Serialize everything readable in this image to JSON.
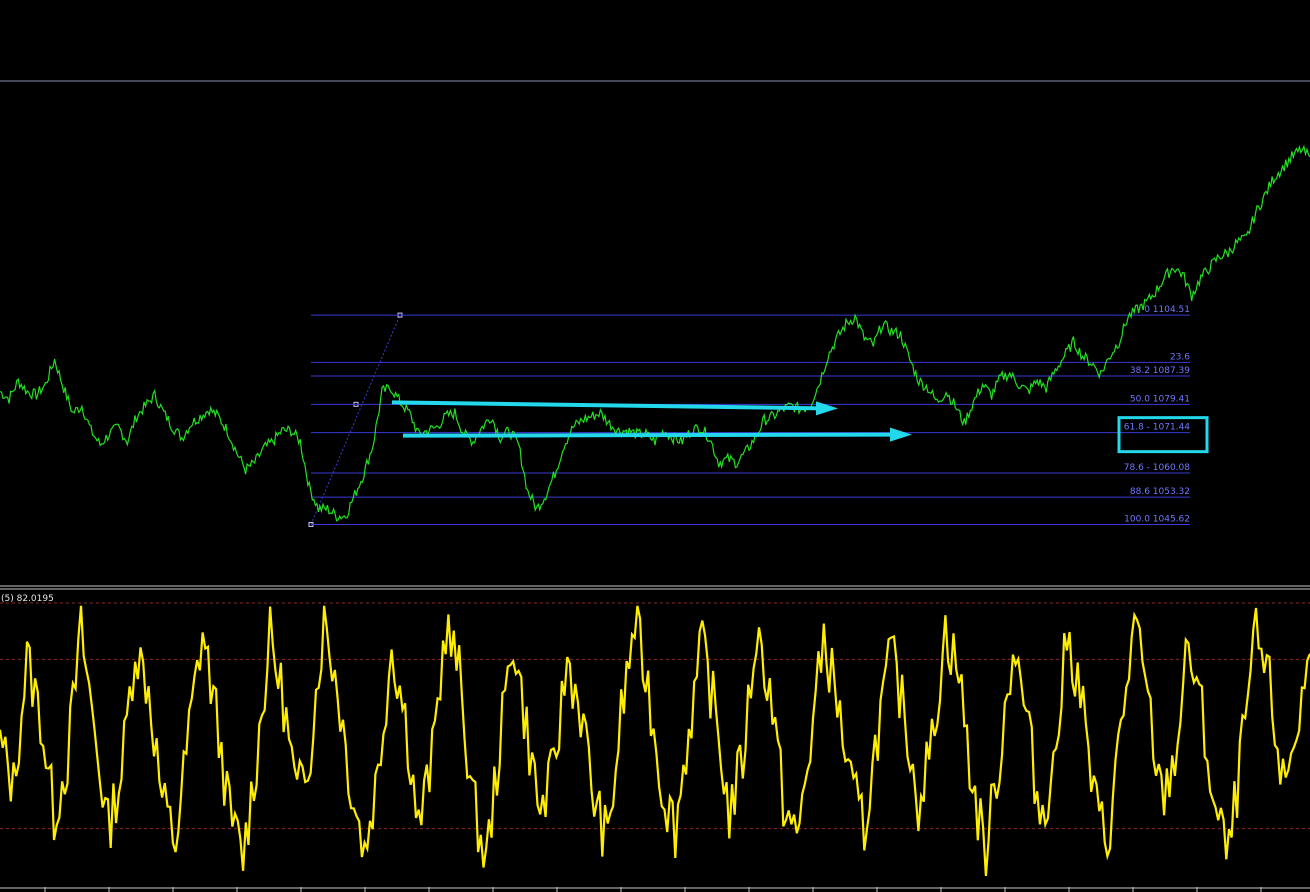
{
  "colors": {
    "background": "#000000",
    "price_line": "#22e022",
    "oscillator_line": "#ffee00",
    "fib_lines": "#3a3ad8",
    "fib_labels": "#6f78ff",
    "annotation_arrows": "#22d8ea",
    "annotation_box": "#22d8ea",
    "separator": "#c8c8c8",
    "level_dashes": "#8a2a2a"
  },
  "chart_data": [
    {
      "type": "line",
      "panel": "price",
      "series": [
        {
          "values": [
            1083,
            1081,
            1086,
            1083,
            1082,
            1085,
            1092,
            1084,
            1077,
            1079,
            1072,
            1068,
            1071,
            1073,
            1069,
            1076,
            1079,
            1082,
            1077,
            1073,
            1070,
            1074,
            1076,
            1078,
            1076,
            1072,
            1066,
            1061,
            1063,
            1067,
            1069,
            1072,
            1072,
            1069,
            1056,
            1050,
            1050,
            1048,
            1048,
            1054,
            1060,
            1068,
            1083,
            1084,
            1080,
            1077,
            1071,
            1072,
            1073,
            1076,
            1077,
            1071,
            1069,
            1073,
            1076,
            1070,
            1072,
            1068,
            1055,
            1050,
            1054,
            1060,
            1068,
            1073,
            1075,
            1076,
            1077,
            1074,
            1072,
            1072,
            1071,
            1071,
            1069,
            1072,
            1070,
            1069,
            1072,
            1073,
            1070,
            1063,
            1064,
            1063,
            1066,
            1070,
            1075,
            1076,
            1078,
            1079,
            1078,
            1079,
            1085,
            1093,
            1098,
            1102,
            1104,
            1098,
            1096,
            1102,
            1100,
            1099,
            1092,
            1086,
            1084,
            1080,
            1083,
            1079,
            1074,
            1080,
            1085,
            1082,
            1087,
            1088,
            1085,
            1083,
            1086,
            1084,
            1089,
            1093,
            1097,
            1093,
            1091,
            1088,
            1093,
            1097,
            1104,
            1106,
            1108,
            1111,
            1115,
            1118,
            1116,
            1110,
            1115,
            1118,
            1121,
            1122,
            1125,
            1126,
            1133,
            1138,
            1143,
            1146,
            1149,
            1151,
            1149
          ]
        }
      ],
      "fibonacci": {
        "levels": [
          {
            "level": "0",
            "value": 1104.51,
            "label": "0 1104.51"
          },
          {
            "level": "23.6",
            "value": 1091.22,
            "label": "23.6"
          },
          {
            "level": "38.2",
            "value": 1087.39,
            "label": "38.2 1087.39"
          },
          {
            "level": "50.0",
            "value": 1079.41,
            "label": "50.0 1079.41"
          },
          {
            "level": "61.8",
            "value": 1071.44,
            "label": "61.8 - 1071.44"
          },
          {
            "level": "78.6",
            "value": 1060.08,
            "label": "78.6 - 1060.08"
          },
          {
            "level": "88.6",
            "value": 1053.32,
            "label": "88.6 1053.32"
          },
          {
            "level": "100.0",
            "value": 1045.62,
            "label": "100.0 1045.62"
          }
        ],
        "highlighted_level": "61.8"
      },
      "annotations": [
        {
          "type": "arrow",
          "color": "cyan",
          "from_level": "50.0",
          "to_level": "50.0"
        },
        {
          "type": "arrow",
          "color": "cyan",
          "from_level": "61.8",
          "to_level": "61.8"
        },
        {
          "type": "box",
          "color": "cyan",
          "around_level": "61.8"
        }
      ]
    },
    {
      "type": "line",
      "panel": "oscillator",
      "title": "(5) 82.0195",
      "ylim": [
        0,
        100
      ],
      "levels": [
        80,
        20
      ],
      "series": [
        {
          "values": [
            50,
            35,
            80,
            60,
            25,
            45,
            90,
            55,
            20,
            40,
            85,
            70,
            30,
            15,
            55,
            90,
            60,
            25,
            10,
            45,
            88,
            65,
            30,
            50,
            95,
            70,
            35,
            12,
            40,
            85,
            60,
            20,
            45,
            92,
            75,
            30,
            8,
            50,
            88,
            55,
            25,
            40,
            80,
            62,
            30,
            15,
            60,
            93,
            70,
            35,
            20,
            55,
            85,
            60,
            25,
            45,
            90,
            70,
            30,
            15,
            50,
            88,
            65,
            35,
            20,
            55,
            82,
            60,
            30,
            50,
            90,
            75,
            35,
            12,
            45,
            85,
            60,
            25,
            40,
            88,
            70,
            30,
            15,
            55,
            92,
            65,
            30,
            45,
            85,
            60,
            25,
            10,
            50,
            88,
            70,
            35,
            55,
            82
          ]
        }
      ]
    }
  ]
}
